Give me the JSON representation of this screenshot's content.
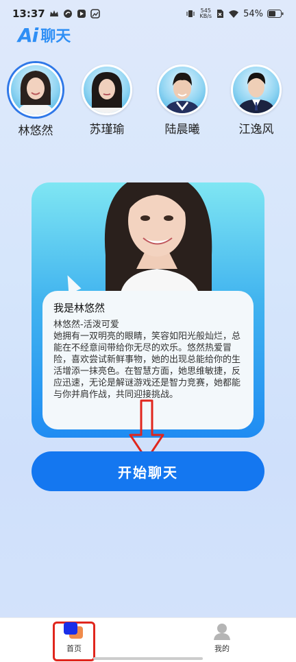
{
  "status_bar": {
    "time": "13:37",
    "net_speed_value": "545",
    "net_speed_unit": "KB/s",
    "battery": "54%"
  },
  "header": {
    "logo_text": "Ai",
    "title": "聊天"
  },
  "characters": [
    {
      "name": "林悠然",
      "selected": true
    },
    {
      "name": "苏瑾瑜",
      "selected": false
    },
    {
      "name": "陆晨曦",
      "selected": false
    },
    {
      "name": "江逸风",
      "selected": false
    }
  ],
  "intro": {
    "heading": "我是林悠然",
    "subtitle": "林悠然-活泼可爱",
    "description": "她拥有一双明亮的眼睛，笑容如阳光般灿烂，总能在不经意间带给你无尽的欢乐。悠然热爱冒险，喜欢尝试新鲜事物，她的出现总能给你的生活增添一抹亮色。在智慧方面，她思维敏捷，反应迅速，无论是解谜游戏还是智力竞赛，她都能与你并肩作战，共同迎接挑战。"
  },
  "start_button": {
    "label": "开始聊天"
  },
  "bottom_nav": {
    "home_label": "首页",
    "mine_label": "我的"
  },
  "colors": {
    "accent": "#1477f0",
    "brand": "#2f8ff5",
    "highlight": "#e0261d"
  }
}
